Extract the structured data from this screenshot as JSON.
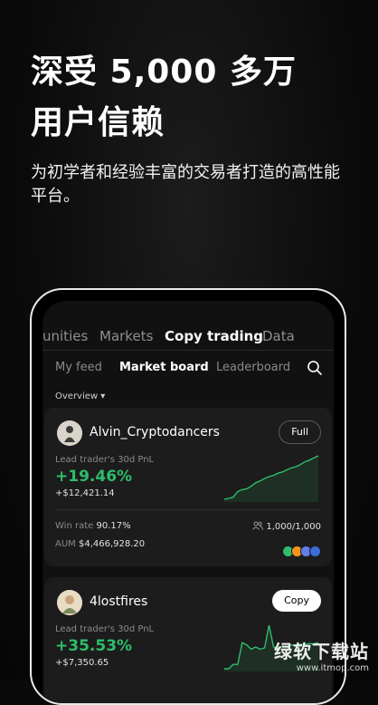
{
  "headline": {
    "line1": "深受 5,000 多万",
    "line2": "用户信赖"
  },
  "subline": "为初学者和经验丰富的交易者打造的高性能平台。",
  "top_nav": [
    "unities",
    "Markets",
    "Copy trading",
    "Data"
  ],
  "top_nav_active": "Copy trading",
  "sub_tabs": [
    "My feed",
    "Market board",
    "Leaderboard"
  ],
  "sub_tabs_active": "Market board",
  "overview_label": "Overview ▾",
  "traders": [
    {
      "name": "Alvin_Cryptodancers",
      "button": "Full",
      "pnl_label": "Lead trader's 30d PnL",
      "pnl_pct": "+19.46%",
      "pnl_amount": "+$12,421.14",
      "win_rate_label": "Win rate",
      "win_rate": "90.17%",
      "followers": "1,000/1,000",
      "aum_label": "AUM",
      "aum": "$4,466,928.20",
      "coins": [
        "#2ebd6b",
        "#f7931a",
        "#627eea",
        "#3b6cd9"
      ],
      "spark": [
        0.0,
        0.02,
        0.05,
        0.18,
        0.22,
        0.24,
        0.3,
        0.38,
        0.42,
        0.48,
        0.52,
        0.55,
        0.6,
        0.63,
        0.68,
        0.72,
        0.75,
        0.8,
        0.86,
        0.9,
        0.95,
        1.0
      ]
    },
    {
      "name": "4lostfires",
      "button": "Copy",
      "pnl_label": "Lead trader's 30d PnL",
      "pnl_pct": "+35.53%",
      "pnl_amount": "+$7,350.65",
      "spark": [
        0.0,
        0.0,
        0.1,
        0.1,
        0.6,
        0.55,
        0.45,
        0.5,
        0.45,
        0.48,
        1.0,
        0.5,
        0.48,
        0.52,
        0.5,
        0.55,
        0.52,
        0.56,
        0.55,
        0.58,
        0.57,
        0.6
      ]
    }
  ],
  "colors": {
    "accent": "#2ebd6b",
    "background": "#0a0a0a",
    "card": "#1c1c1c"
  },
  "icons": {
    "search": "search-icon",
    "followers": "users-icon"
  },
  "watermark": {
    "title": "绿软下载站",
    "url": "www.itmop.com"
  }
}
